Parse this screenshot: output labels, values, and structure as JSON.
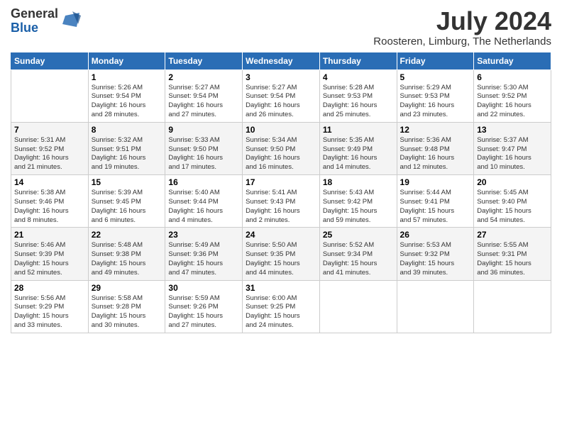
{
  "logo": {
    "general": "General",
    "blue": "Blue"
  },
  "title": {
    "month_year": "July 2024",
    "location": "Roosteren, Limburg, The Netherlands"
  },
  "headers": [
    "Sunday",
    "Monday",
    "Tuesday",
    "Wednesday",
    "Thursday",
    "Friday",
    "Saturday"
  ],
  "weeks": [
    [
      {
        "day": "",
        "info": ""
      },
      {
        "day": "1",
        "info": "Sunrise: 5:26 AM\nSunset: 9:54 PM\nDaylight: 16 hours\nand 28 minutes."
      },
      {
        "day": "2",
        "info": "Sunrise: 5:27 AM\nSunset: 9:54 PM\nDaylight: 16 hours\nand 27 minutes."
      },
      {
        "day": "3",
        "info": "Sunrise: 5:27 AM\nSunset: 9:54 PM\nDaylight: 16 hours\nand 26 minutes."
      },
      {
        "day": "4",
        "info": "Sunrise: 5:28 AM\nSunset: 9:53 PM\nDaylight: 16 hours\nand 25 minutes."
      },
      {
        "day": "5",
        "info": "Sunrise: 5:29 AM\nSunset: 9:53 PM\nDaylight: 16 hours\nand 23 minutes."
      },
      {
        "day": "6",
        "info": "Sunrise: 5:30 AM\nSunset: 9:52 PM\nDaylight: 16 hours\nand 22 minutes."
      }
    ],
    [
      {
        "day": "7",
        "info": "Sunrise: 5:31 AM\nSunset: 9:52 PM\nDaylight: 16 hours\nand 21 minutes."
      },
      {
        "day": "8",
        "info": "Sunrise: 5:32 AM\nSunset: 9:51 PM\nDaylight: 16 hours\nand 19 minutes."
      },
      {
        "day": "9",
        "info": "Sunrise: 5:33 AM\nSunset: 9:50 PM\nDaylight: 16 hours\nand 17 minutes."
      },
      {
        "day": "10",
        "info": "Sunrise: 5:34 AM\nSunset: 9:50 PM\nDaylight: 16 hours\nand 16 minutes."
      },
      {
        "day": "11",
        "info": "Sunrise: 5:35 AM\nSunset: 9:49 PM\nDaylight: 16 hours\nand 14 minutes."
      },
      {
        "day": "12",
        "info": "Sunrise: 5:36 AM\nSunset: 9:48 PM\nDaylight: 16 hours\nand 12 minutes."
      },
      {
        "day": "13",
        "info": "Sunrise: 5:37 AM\nSunset: 9:47 PM\nDaylight: 16 hours\nand 10 minutes."
      }
    ],
    [
      {
        "day": "14",
        "info": "Sunrise: 5:38 AM\nSunset: 9:46 PM\nDaylight: 16 hours\nand 8 minutes."
      },
      {
        "day": "15",
        "info": "Sunrise: 5:39 AM\nSunset: 9:45 PM\nDaylight: 16 hours\nand 6 minutes."
      },
      {
        "day": "16",
        "info": "Sunrise: 5:40 AM\nSunset: 9:44 PM\nDaylight: 16 hours\nand 4 minutes."
      },
      {
        "day": "17",
        "info": "Sunrise: 5:41 AM\nSunset: 9:43 PM\nDaylight: 16 hours\nand 2 minutes."
      },
      {
        "day": "18",
        "info": "Sunrise: 5:43 AM\nSunset: 9:42 PM\nDaylight: 15 hours\nand 59 minutes."
      },
      {
        "day": "19",
        "info": "Sunrise: 5:44 AM\nSunset: 9:41 PM\nDaylight: 15 hours\nand 57 minutes."
      },
      {
        "day": "20",
        "info": "Sunrise: 5:45 AM\nSunset: 9:40 PM\nDaylight: 15 hours\nand 54 minutes."
      }
    ],
    [
      {
        "day": "21",
        "info": "Sunrise: 5:46 AM\nSunset: 9:39 PM\nDaylight: 15 hours\nand 52 minutes."
      },
      {
        "day": "22",
        "info": "Sunrise: 5:48 AM\nSunset: 9:38 PM\nDaylight: 15 hours\nand 49 minutes."
      },
      {
        "day": "23",
        "info": "Sunrise: 5:49 AM\nSunset: 9:36 PM\nDaylight: 15 hours\nand 47 minutes."
      },
      {
        "day": "24",
        "info": "Sunrise: 5:50 AM\nSunset: 9:35 PM\nDaylight: 15 hours\nand 44 minutes."
      },
      {
        "day": "25",
        "info": "Sunrise: 5:52 AM\nSunset: 9:34 PM\nDaylight: 15 hours\nand 41 minutes."
      },
      {
        "day": "26",
        "info": "Sunrise: 5:53 AM\nSunset: 9:32 PM\nDaylight: 15 hours\nand 39 minutes."
      },
      {
        "day": "27",
        "info": "Sunrise: 5:55 AM\nSunset: 9:31 PM\nDaylight: 15 hours\nand 36 minutes."
      }
    ],
    [
      {
        "day": "28",
        "info": "Sunrise: 5:56 AM\nSunset: 9:29 PM\nDaylight: 15 hours\nand 33 minutes."
      },
      {
        "day": "29",
        "info": "Sunrise: 5:58 AM\nSunset: 9:28 PM\nDaylight: 15 hours\nand 30 minutes."
      },
      {
        "day": "30",
        "info": "Sunrise: 5:59 AM\nSunset: 9:26 PM\nDaylight: 15 hours\nand 27 minutes."
      },
      {
        "day": "31",
        "info": "Sunrise: 6:00 AM\nSunset: 9:25 PM\nDaylight: 15 hours\nand 24 minutes."
      },
      {
        "day": "",
        "info": ""
      },
      {
        "day": "",
        "info": ""
      },
      {
        "day": "",
        "info": ""
      }
    ]
  ]
}
